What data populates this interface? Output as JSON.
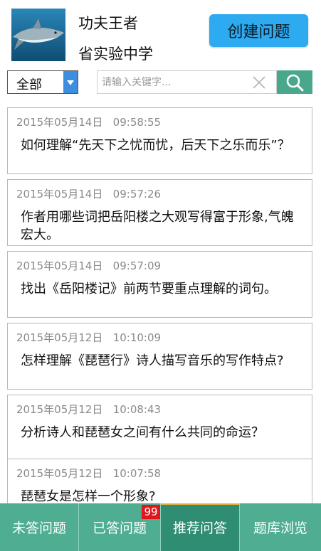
{
  "header": {
    "user_name": "功夫王者",
    "school": "省实验中学",
    "create_button": "创建问题"
  },
  "filter": {
    "selected": "全部"
  },
  "search": {
    "placeholder": "请输入关键字..."
  },
  "questions": [
    {
      "date": "2015年05月14日",
      "time": "09:58:55",
      "text": "如何理解“先天下之忧而忧，后天下之乐而乐”？"
    },
    {
      "date": "2015年05月14日",
      "time": "09:57:26",
      "text": "作者用哪些词把岳阳楼之大观写得富于形象,气魄宏大。"
    },
    {
      "date": "2015年05月14日",
      "time": "09:57:09",
      "text": "找出《岳阳楼记》前两节要重点理解的词句。"
    },
    {
      "date": "2015年05月12日",
      "time": "10:10:09",
      "text": "怎样理解《琵琶行》诗人描写音乐的写作特点?"
    },
    {
      "date": "2015年05月12日",
      "time": "10:08:43",
      "text": "分析诗人和琵琶女之间有什么共同的命运？"
    },
    {
      "date": "2015年05月12日",
      "time": "10:07:58",
      "text": "琵琶女是怎样一个形象?"
    }
  ],
  "tabs": [
    {
      "label": "未答问题"
    },
    {
      "label": "已答问题",
      "badge": "99"
    },
    {
      "label": "推荐问答"
    },
    {
      "label": "题库浏览"
    }
  ],
  "active_tab": "推荐问答",
  "colors": {
    "accent": "#2eaaf0",
    "tabbar": "#4fae92",
    "tab_active": "#2e8d72",
    "badge": "#e0161d",
    "search_button": "#49a88c"
  },
  "icons": {
    "avatar": "shark-photo",
    "dropdown": "triangle-down-icon",
    "clear": "close-icon",
    "search": "search-icon"
  }
}
